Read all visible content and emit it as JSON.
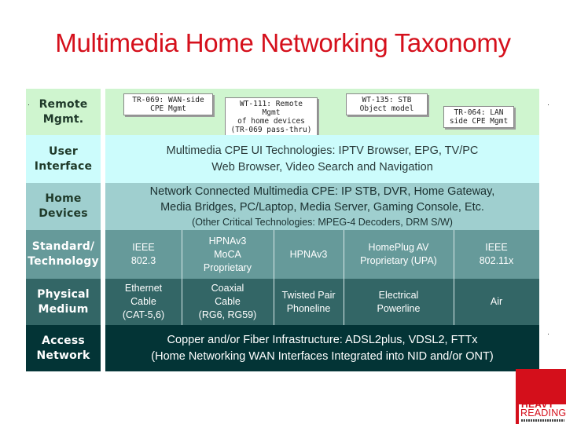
{
  "title": "Multimedia Home Networking Taxonomy",
  "colors": {
    "title": "#d5101c",
    "remote_mgmt_row": "#cff5cf",
    "user_interface_row": "#ccfcfc",
    "home_devices_row": "#9fcfcf",
    "standard_row": "#669a9a",
    "physical_row": "#336666",
    "access_row": "#033436",
    "logo": "#d40f1b"
  },
  "rows": {
    "remote_mgmt": {
      "label_line1": "Remote",
      "label_line2": "Mgmt.",
      "standards": [
        {
          "line1": "TR-069: WAN-side",
          "line2": "CPE Mgmt",
          "line3": ""
        },
        {
          "line1": "WT-111: Remote Mgmt",
          "line2": "of home devices",
          "line3": "(TR-069 pass-thru)"
        },
        {
          "line1": "WT-135: STB",
          "line2": "Object model",
          "line3": ""
        },
        {
          "line1": "TR-064: LAN",
          "line2": "side CPE Mgmt",
          "line3": ""
        }
      ]
    },
    "user_interface": {
      "label_line1": "User",
      "label_line2": "Interface",
      "line1": "Multimedia CPE UI Technologies: IPTV Browser, EPG, TV/PC",
      "line2": "Web Browser, Video Search and Navigation"
    },
    "home_devices": {
      "label_line1": "Home",
      "label_line2": "Devices",
      "line1": "Network Connected Multimedia CPE: IP STB, DVR, Home Gateway,",
      "line2": "Media Bridges, PC/Laptop, Media Server, Gaming Console, Etc.",
      "line3": "(Other Critical Technologies: MPEG-4 Decoders, DRM S/W)"
    },
    "standard": {
      "label_line1": "Standard/",
      "label_line2": "Technology",
      "cells": [
        {
          "line1": "IEEE",
          "line2": "802.3",
          "line3": ""
        },
        {
          "line1": "HPNAv3",
          "line2": "MoCA",
          "line3": "Proprietary"
        },
        {
          "line1": "HPNAv3",
          "line2": "",
          "line3": ""
        },
        {
          "line1": "HomePlug AV",
          "line2": "Proprietary (UPA)",
          "line3": ""
        },
        {
          "line1": "IEEE",
          "line2": "802.11x",
          "line3": ""
        }
      ]
    },
    "physical": {
      "label_line1": "Physical",
      "label_line2": "Medium",
      "cells": [
        {
          "line1": "Ethernet",
          "line2": "Cable",
          "line3": "(CAT-5,6)"
        },
        {
          "line1": "Coaxial",
          "line2": "Cable",
          "line3": "(RG6, RG59)"
        },
        {
          "line1": "Twisted Pair",
          "line2": "Phoneline",
          "line3": ""
        },
        {
          "line1": "Electrical",
          "line2": "Powerline",
          "line3": ""
        },
        {
          "line1": "Air",
          "line2": "",
          "line3": ""
        }
      ]
    },
    "access": {
      "label_line1": "Access",
      "label_line2": "Network",
      "line1": "Copper and/or Fiber Infrastructure: ADSL2plus, VDSL2, FTTx",
      "line2": "(Home Networking WAN Interfaces Integrated into NID and/or ONT)"
    }
  },
  "logo": {
    "line1": "HEAVY",
    "line2": "READING"
  }
}
